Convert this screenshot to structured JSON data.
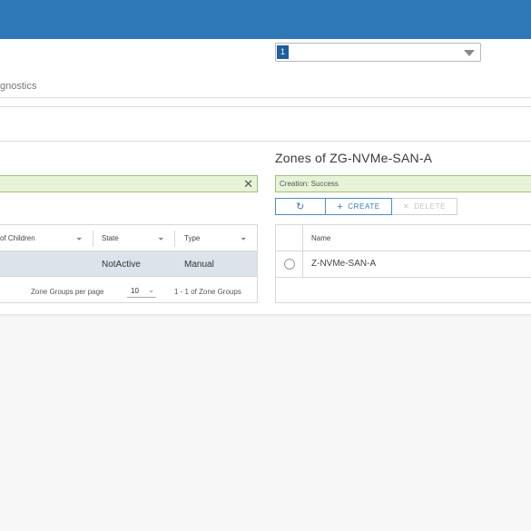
{
  "colors": {
    "accent": "#2e78b7",
    "success_bg": "#e6f3d6",
    "success_border": "#9ec17a",
    "selected_row": "#dde3ea"
  },
  "header": {
    "dropdown_value": "1"
  },
  "nav": {
    "tab_label": "gnostics"
  },
  "left_panel": {
    "filter_clear_icon": "close-icon",
    "columns": [
      {
        "label": "of Children",
        "filter_icon": "filter-icon"
      },
      {
        "label": "State",
        "filter_icon": "filter-icon"
      },
      {
        "label": "Type",
        "filter_icon": "filter-icon"
      }
    ],
    "rows": [
      {
        "state": "NotActive",
        "type": "Manual"
      }
    ],
    "footer": {
      "per_page_label": "Zone Groups per page",
      "per_page_value": "10",
      "range_label": "1 - 1 of Zone Groups"
    }
  },
  "right_panel": {
    "title": "Zones of ZG-NVMe-SAN-A",
    "status_text": "Creation: Success",
    "toolbar": {
      "refresh_icon": "refresh-icon",
      "create_label": "CREATE",
      "delete_label": "DELETE"
    },
    "columns": [
      {
        "label": "Name"
      }
    ],
    "rows": [
      {
        "name": "Z-NVMe-SAN-A"
      }
    ]
  }
}
